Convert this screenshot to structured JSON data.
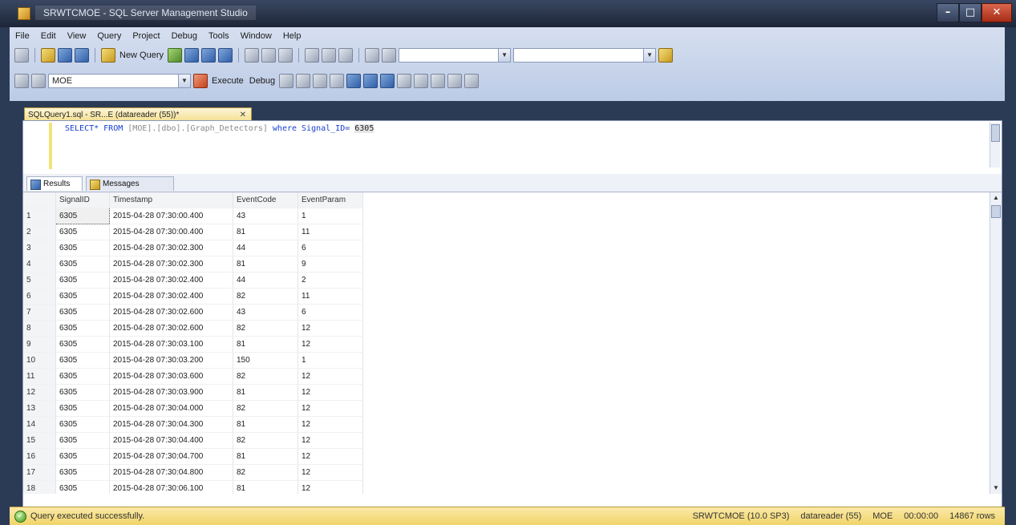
{
  "window": {
    "title": "SRWTCMOE - SQL Server Management Studio"
  },
  "menu": [
    "File",
    "Edit",
    "View",
    "Query",
    "Project",
    "Debug",
    "Tools",
    "Window",
    "Help"
  ],
  "toolbar": {
    "new_query_label": "New Query",
    "database": "MOE",
    "execute_label": "Execute",
    "debug_label": "Debug"
  },
  "document_tab": {
    "title": "SQLQuery1.sql - SR...E (datareader (55))*",
    "close": "✕"
  },
  "editor": {
    "keyword_select": "SELECT",
    "star_from": "* FROM ",
    "table_ref": "[MOE].[dbo].[Graph_Detectors]",
    "where_clause": " where Signal_ID= ",
    "value": "6305"
  },
  "result_tabs": {
    "results": "Results",
    "messages": "Messages"
  },
  "grid": {
    "columns": [
      "SignalID",
      "Timestamp",
      "EventCode",
      "EventParam"
    ],
    "rows": [
      [
        "1",
        "6305",
        "2015-04-28 07:30:00.400",
        "43",
        "1"
      ],
      [
        "2",
        "6305",
        "2015-04-28 07:30:00.400",
        "81",
        "11"
      ],
      [
        "3",
        "6305",
        "2015-04-28 07:30:02.300",
        "44",
        "6"
      ],
      [
        "4",
        "6305",
        "2015-04-28 07:30:02.300",
        "81",
        "9"
      ],
      [
        "5",
        "6305",
        "2015-04-28 07:30:02.400",
        "44",
        "2"
      ],
      [
        "6",
        "6305",
        "2015-04-28 07:30:02.400",
        "82",
        "11"
      ],
      [
        "7",
        "6305",
        "2015-04-28 07:30:02.600",
        "43",
        "6"
      ],
      [
        "8",
        "6305",
        "2015-04-28 07:30:02.600",
        "82",
        "12"
      ],
      [
        "9",
        "6305",
        "2015-04-28 07:30:03.100",
        "81",
        "12"
      ],
      [
        "10",
        "6305",
        "2015-04-28 07:30:03.200",
        "150",
        "1"
      ],
      [
        "11",
        "6305",
        "2015-04-28 07:30:03.600",
        "82",
        "12"
      ],
      [
        "12",
        "6305",
        "2015-04-28 07:30:03.900",
        "81",
        "12"
      ],
      [
        "13",
        "6305",
        "2015-04-28 07:30:04.000",
        "82",
        "12"
      ],
      [
        "14",
        "6305",
        "2015-04-28 07:30:04.300",
        "81",
        "12"
      ],
      [
        "15",
        "6305",
        "2015-04-28 07:30:04.400",
        "82",
        "12"
      ],
      [
        "16",
        "6305",
        "2015-04-28 07:30:04.700",
        "81",
        "12"
      ],
      [
        "17",
        "6305",
        "2015-04-28 07:30:04.800",
        "82",
        "12"
      ],
      [
        "18",
        "6305",
        "2015-04-28 07:30:06.100",
        "81",
        "12"
      ]
    ]
  },
  "status": {
    "message": "Query executed successfully.",
    "server": "SRWTCMOE (10.0 SP3)",
    "user": "datareader (55)",
    "database": "MOE",
    "elapsed": "00:00:00",
    "rows": "14867 rows"
  },
  "colors": {
    "status_bar": "#f0d46a",
    "window_frame": "#2b3a55",
    "tab_active": "#f3df8e"
  }
}
